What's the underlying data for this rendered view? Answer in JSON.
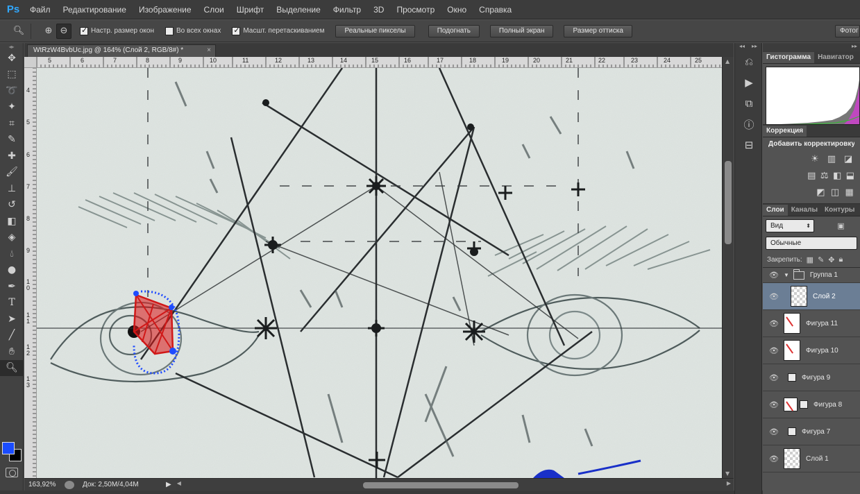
{
  "app": {
    "logo": "Ps"
  },
  "menu": [
    "Файл",
    "Редактирование",
    "Изображение",
    "Слои",
    "Шрифт",
    "Выделение",
    "Фильтр",
    "3D",
    "Просмотр",
    "Окно",
    "Справка"
  ],
  "options": {
    "check_resize_windows": "Настр. размер окон",
    "check_all_windows": "Во всех окнах",
    "check_scrubby_zoom": "Масшт. перетаскиванием",
    "btn_actual_pixels": "Реальные пикселы",
    "btn_fit": "Подогнать",
    "btn_fullscreen": "Полный экран",
    "btn_print_size": "Размер оттиска",
    "btn_photo": "Фотог"
  },
  "document": {
    "tab_title": "WtRzW4BvbUc.jpg @ 164% (Слой 2, RGB/8#) *",
    "close": "×"
  },
  "ruler": {
    "h_labels": [
      "5",
      "6",
      "7",
      "8",
      "9",
      "10",
      "11",
      "12",
      "13",
      "14",
      "15",
      "16",
      "17",
      "18",
      "19",
      "20",
      "21",
      "22",
      "23",
      "24",
      "25"
    ],
    "v_labels": [
      "4",
      "5",
      "6",
      "7",
      "8",
      "9",
      "10",
      "11",
      "12",
      "13"
    ]
  },
  "status": {
    "zoom": "163,92%",
    "doc_size": "Док: 2,50M/4,04M",
    "arrow": "▶"
  },
  "colors": {
    "foreground": "#1a4cff",
    "background": "#000000",
    "accent_selection": "#6b7e95"
  },
  "panels": {
    "tab_histogram": "Гистограмма",
    "tab_navigator": "Навигатор",
    "tab_correction": "Коррекция",
    "correction_title": "Добавить корректировку",
    "tab_layers": "Слои",
    "tab_channels": "Каналы",
    "tab_paths": "Контуры",
    "kind_filter": "Вид",
    "blend_mode": "Обычные",
    "lock_label": "Закрепить:"
  },
  "layers": [
    {
      "name": "Группа 1",
      "type": "group"
    },
    {
      "name": "Слой 2",
      "type": "raster",
      "selected": true
    },
    {
      "name": "Фигура 11",
      "type": "shape"
    },
    {
      "name": "Фигура 10",
      "type": "shape"
    },
    {
      "name": "Фигура 9",
      "type": "shape-mask"
    },
    {
      "name": "Фигура 8",
      "type": "shape"
    },
    {
      "name": "Фигура 7",
      "type": "shape-mask"
    },
    {
      "name": "Слой 1",
      "type": "raster"
    }
  ]
}
